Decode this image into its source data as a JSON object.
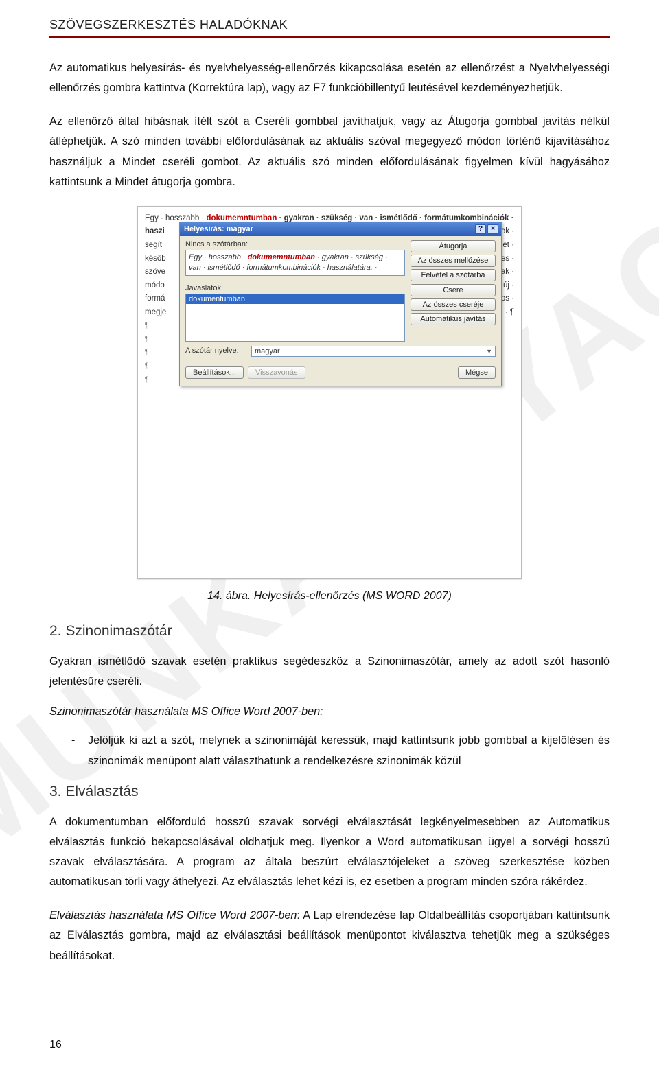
{
  "watermark": "MUNKAANYAG",
  "header": "SZÖVEGSZERKESZTÉS HALADÓKNAK",
  "para1": "Az automatikus helyesírás- és nyelvhelyesség-ellenőrzés kikapcsolása esetén az ellenőrzést a Nyelvhelyességi ellenőrzés gombra kattintva (Korrektúra lap), vagy az F7 funkcióbillentyű leütésével kezdeményezhetjük.",
  "para2": "Az ellenőrző által hibásnak ítélt szót a Cseréli gombbal javíthatjuk, vagy az Átugorja gombbal javítás nélkül átléphetjük. A szó minden további előfordulásának az aktuális szóval megegyező módon történő kijavításához használjuk a Mindet cseréli gombot. Az aktuális szó minden előfordulásának figyelmen kívül hagyásához kattintsunk a Mindet átugorja gombra.",
  "caption": "14. ábra. Helyesírás-ellenőrzés (MS WORD 2007)",
  "section2_title": "2. Szinonimaszótár",
  "section2_para": "Gyakran ismétlődő szavak esetén praktikus segédeszköz a Szinonimaszótár, amely az adott szót hasonló jelentésűre cseréli.",
  "section2_italic": "Szinonimaszótár használata MS Office Word 2007-ben:",
  "section2_bullet": "Jelöljük ki azt a szót, melynek a szinonimáját keressük, majd kattintsunk jobb gombbal a kijelölésen és szinonimák menüpont alatt választhatunk a rendelkezésre szinonimák közül",
  "section3_title": "3. Elválasztás",
  "section3_para1": "A dokumentumban előforduló hosszú szavak sorvégi elválasztását legkényelmesebben az Automatikus elválasztás funkció bekapcsolásával oldhatjuk meg. Ilyenkor a Word automatikusan ügyel a sorvégi hosszú szavak elválasztására. A program az általa beszúrt elválasztójeleket a szöveg szerkesztése közben automatikusan törli vagy áthelyezi. Az elválasztás lehet kézi is, ez esetben a program minden szóra rákérdez.",
  "section3_para2_prefix": "Elválasztás használata MS Office Word 2007-ben",
  "section3_para2_rest": ": A Lap elrendezése lap Oldalbeállítás csoportjában kattintsunk az Elválasztás gombra, majd az elválasztási beállítások menüpontot kiválasztva tehetjük meg a szükséges beállításokat.",
  "page_number": "16",
  "screenshot": {
    "bg_line1_pre": "Egy · hosszabb · ",
    "bg_line1_red": "dokumemntumban",
    "bg_line1_post": " · gyakran · szükség · van · ismétlődő · formátumkombinációk ·",
    "bg_right_frag1": "mátuma · is. · A · stílusok ·",
    "bg_right_frag2": "kothatunk, · melyeket ·",
    "bg_right_frag3": "sára. · A · következetes ·",
    "bg_right_frag4": "stílus · formátumainak ·",
    "bg_right_frag5": "ikusan · felveszi · az · új ·",
    "bg_right_frag6": "n · tehetünk · azonos ·",
    "bg_right_frag7": "ől · a · másikba. · ¶",
    "bg_left_words": [
      "haszi",
      "segít",
      "későb",
      "szöve",
      "módo",
      "formá",
      "megje"
    ],
    "dialog": {
      "title": "Helyesírás: magyar",
      "lbl_not_in_dict": "Nincs a szótárban:",
      "sentence_pre": "Egy · hosszabb · ",
      "sentence_red": "dokumemntumban",
      "sentence_post": " · gyakran · szükség · van · ismétlődő · formátumkombinációk · használatára. ·",
      "lbl_suggestions": "Javaslatok:",
      "suggestion_selected": "dokumentumban",
      "lbl_lang": "A szótár nyelve:",
      "lang_value": "magyar",
      "btn_ignore": "Átugorja",
      "btn_ignore_all": "Az összes mellőzése",
      "btn_add": "Felvétel a szótárba",
      "btn_change": "Csere",
      "btn_change_all": "Az összes cseréje",
      "btn_autocorrect": "Automatikus javítás",
      "btn_options": "Beállítások...",
      "btn_undo": "Visszavonás",
      "btn_cancel": "Mégse",
      "win_help": "?",
      "win_close": "×"
    }
  }
}
